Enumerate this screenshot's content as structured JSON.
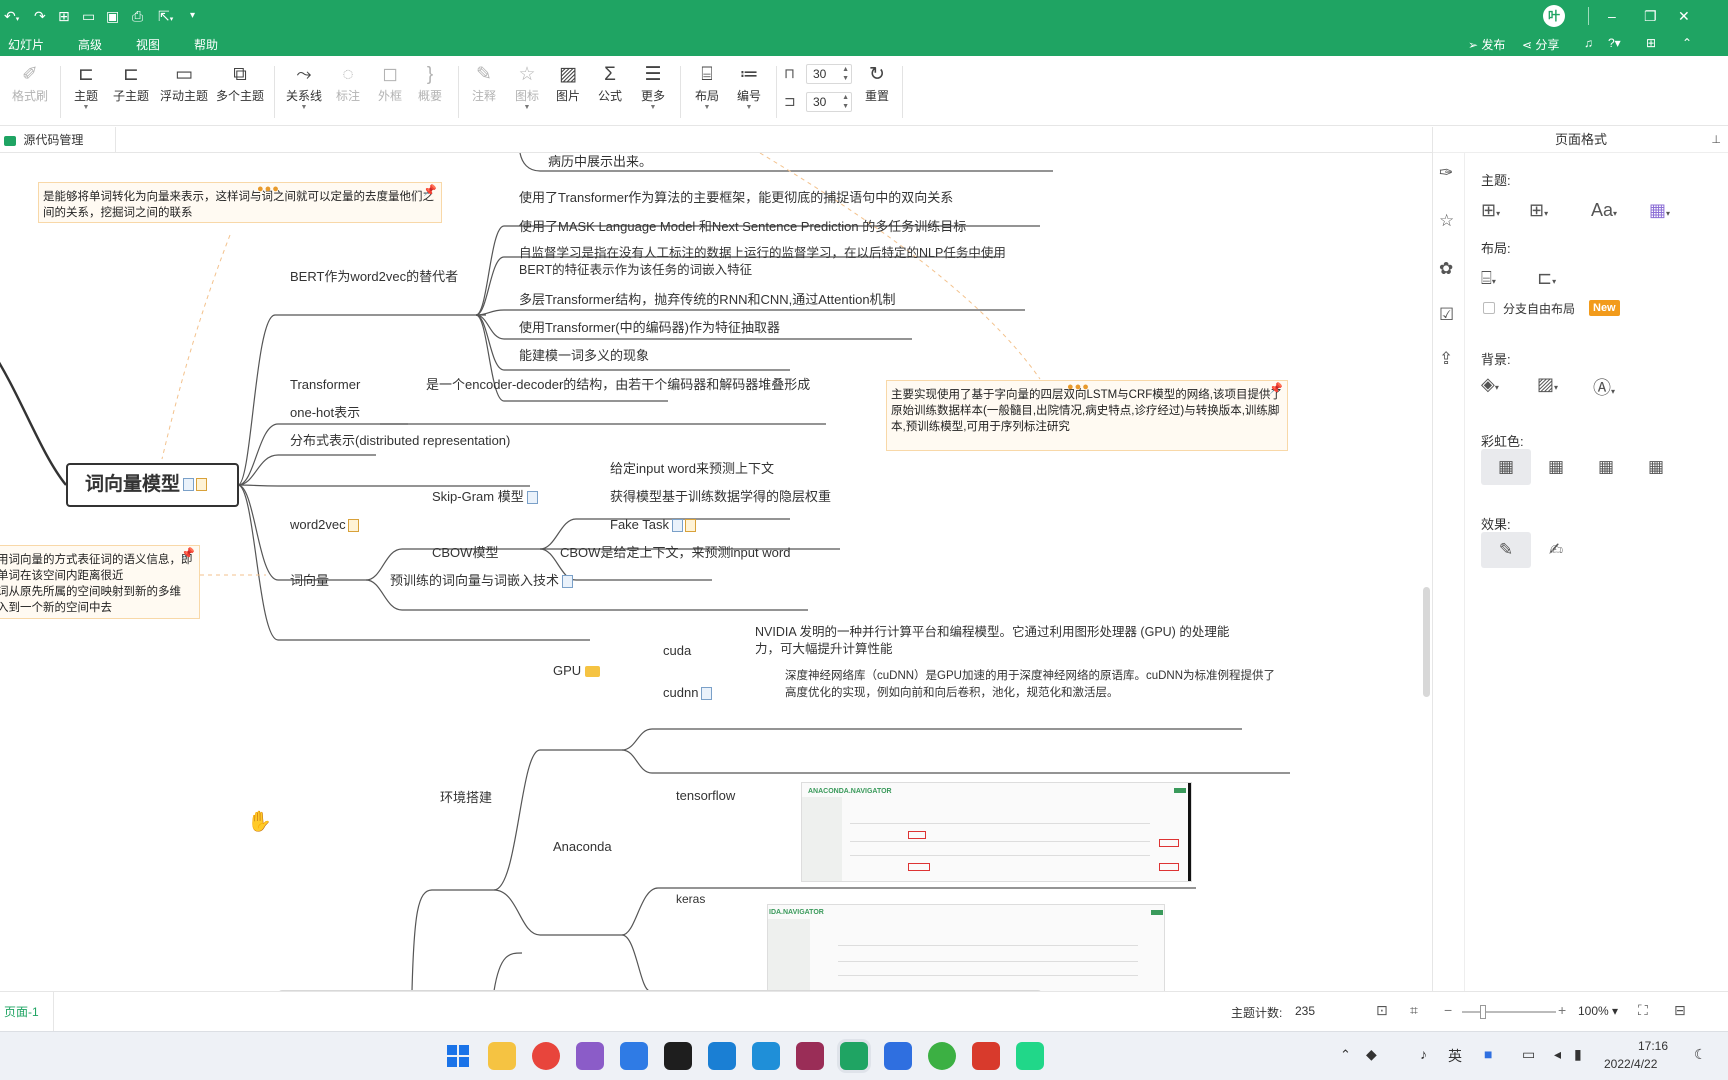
{
  "menu": {
    "items": [
      "幻灯片",
      "高级",
      "视图",
      "帮助"
    ],
    "publish": "发布",
    "share": "分享",
    "avatar": "叶"
  },
  "toolbar": {
    "tools": [
      {
        "label": "格式刷",
        "disabled": true
      },
      {
        "label": "主题",
        "disabled": false
      },
      {
        "label": "子主题",
        "disabled": false
      },
      {
        "label": "浮动主题",
        "disabled": false
      },
      {
        "label": "多个主题",
        "disabled": false
      },
      {
        "label": "关系线",
        "disabled": false
      },
      {
        "label": "标注",
        "disabled": true
      },
      {
        "label": "外框",
        "disabled": true
      },
      {
        "label": "概要",
        "disabled": true
      },
      {
        "label": "注释",
        "disabled": true
      },
      {
        "label": "图标",
        "disabled": true
      },
      {
        "label": "图片",
        "disabled": false
      },
      {
        "label": "公式",
        "disabled": false
      },
      {
        "label": "更多",
        "disabled": false
      },
      {
        "label": "布局",
        "disabled": false
      },
      {
        "label": "编号",
        "disabled": false
      },
      {
        "label": "重置",
        "disabled": false
      }
    ],
    "spacing_h": "30",
    "spacing_v": "30"
  },
  "tab": {
    "label": "源代码管理"
  },
  "mindmap": {
    "top_cut_text": "病历中展示出来。",
    "central": "词向量模型",
    "notes": {
      "note1": "是能够将单词转化为向量来表示，这样词与词之间就可以定量的去度量他们之间的关系，挖掘词之间的联系",
      "note2": "主要实现使用了基于字向量的四层双向LSTM与CRF模型的网络,该项目提供了原始训练数据样本(一般髓目,出院情况,病史特点,诊疗经过)与转换版本,训练脚本,预训练模型,可用于序列标注研究",
      "note3_lines": [
        "用词向量的方式表征词的语义信息，即",
        "单词在该空间内距离很近",
        "词从原先所属的空间映射到新的多维",
        "入到一个新的空间中去"
      ]
    },
    "bert": {
      "label": "BERT作为word2vec的替代者",
      "children": [
        "使用了Transformer作为算法的主要框架，能更彻底的捕捉语句中的双向关系",
        "使用了MASK Language Model 和Next Sentence Prediction 的多任务训练目标",
        "自监督学习是指在没有人工标注的数据上运行的监督学习，在以后特定的NLP任务中使用BERT的特征表示作为该任务的词嵌入特征",
        "多层Transformer结构，抛弃传统的RNN和CNN,通过Attention机制",
        "使用Transformer(中的编码器)作为特征抽取器",
        "能建模一词多义的现象"
      ]
    },
    "transformer": {
      "label": "Transformer",
      "child": "是一个encoder-decoder的结构，由若干个编码器和解码器堆叠形成"
    },
    "onehot": "one-hot表示",
    "distributed": "分布式表示(distributed representation)",
    "word2vec": {
      "label": "word2vec",
      "skipgram": {
        "label": "Skip-Gram 模型",
        "children": [
          "给定input word来预测上下文",
          "获得模型基于训练数据学得的隐层权重",
          "Fake Task"
        ]
      },
      "cbow": {
        "label": "CBOW模型",
        "child": "CBOW是给定上下文，来预测input word"
      }
    },
    "wordvec": {
      "label": "词向量",
      "child": "预训练的词向量与词嵌入技术"
    },
    "env": {
      "label": "环境搭建",
      "gpu": {
        "label": "GPU",
        "cuda": {
          "label": "cuda",
          "desc": "NVIDIA 发明的一种并行计算平台和编程模型。它通过利用图形处理器 (GPU) 的处理能力，可大幅提升计算性能"
        },
        "cudnn": {
          "label": "cudnn",
          "desc": "深度神经网络库（cuDNN）是GPU加速的用于深度神经网络的原语库。cuDNN为标准例程提供了高度优化的实现，例如向前和向后卷积，池化，规范化和激活层。"
        }
      },
      "anaconda": {
        "label": "Anaconda",
        "children": [
          "tensorflow",
          "keras"
        ]
      },
      "shot1_title": "ANACONDA.NAVIGATOR",
      "shot2_title": "IDA.NAVIGATOR"
    }
  },
  "panel": {
    "title": "页面格式",
    "theme_label": "主题:",
    "layout_label": "布局:",
    "free_layout": "分支自由布局",
    "new_badge": "New",
    "bg_label": "背景:",
    "rainbow_label": "彩虹色:",
    "effect_label": "效果:"
  },
  "status": {
    "page": "页面-1",
    "topic_count_label": "主题计数:",
    "topic_count": "235",
    "zoom": "100%"
  },
  "tray": {
    "ime": "英",
    "time": "17:16",
    "date": "2022/4/22"
  },
  "colors": {
    "brand": "#1fa463",
    "note_border": "#f8d8a8",
    "new_badge": "#f29b1b"
  }
}
